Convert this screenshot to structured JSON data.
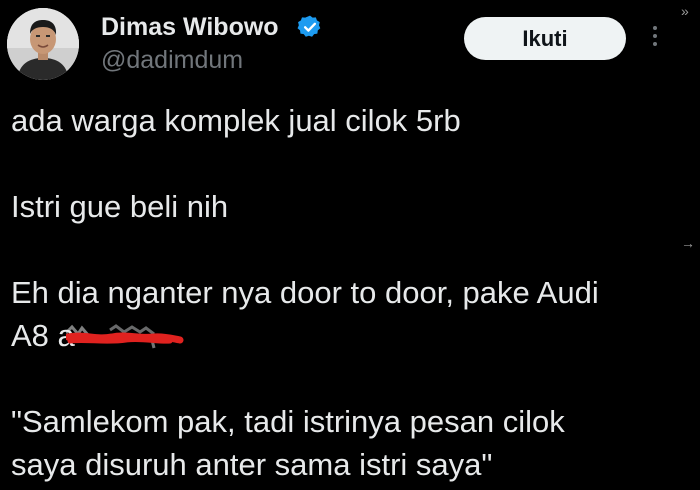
{
  "author": {
    "display_name": "Dimas Wibowo",
    "handle": "@dadimdum",
    "verified": true
  },
  "actions": {
    "follow_label": "Ikuti",
    "more_icon": "more-vertical-icon"
  },
  "side_icons": {
    "top": "»",
    "middle": "→"
  },
  "tweet": {
    "line1": "ada warga komplek jual cilok 5rb",
    "line2": "Istri gue beli nih",
    "line3": "Eh dia nganter nya door to door, pake Audi",
    "line4_visible": "A8 a",
    "line5": "\"Samlekom pak, tadi istrinya pesan cilok",
    "line6": "saya disuruh anter sama istri saya\""
  },
  "colors": {
    "background": "#000000",
    "text": "#e7e9ea",
    "secondary": "#71767b",
    "button_bg": "#eff3f4",
    "verified": "#1d9bf0",
    "redaction": "#e0221f"
  }
}
